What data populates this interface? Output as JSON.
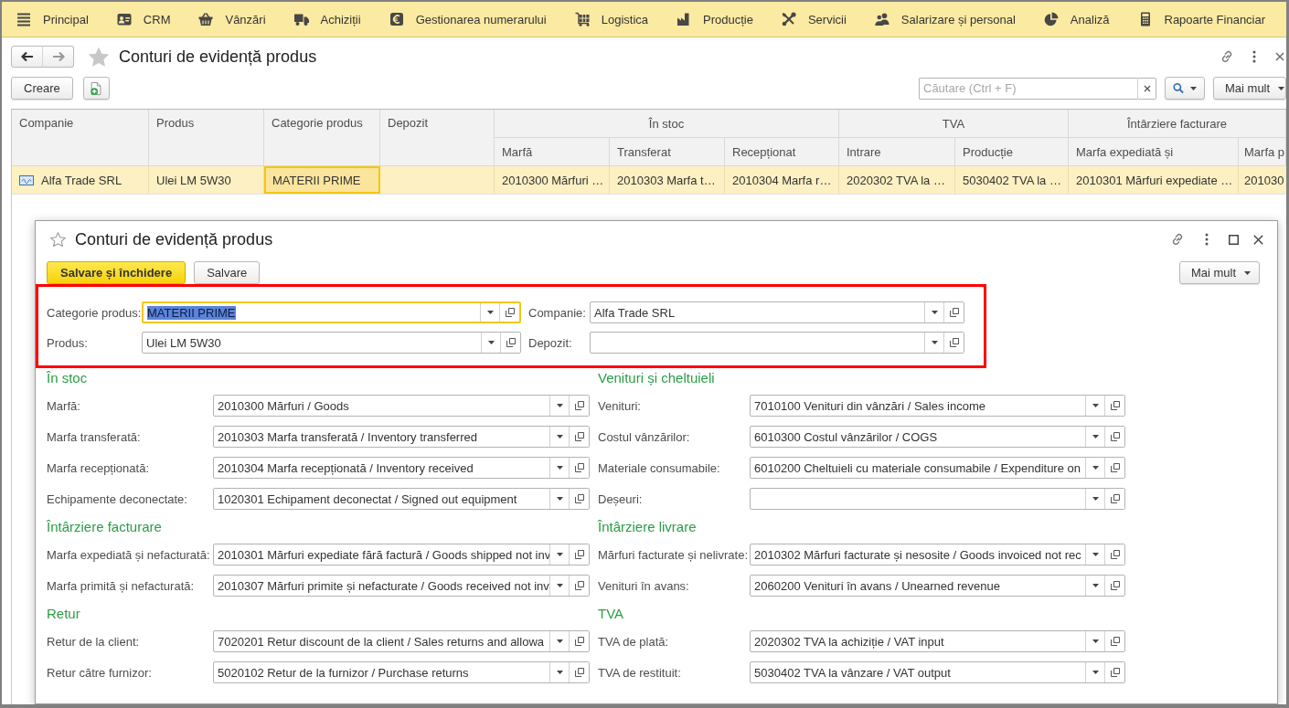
{
  "menu_bar": {
    "items": [
      "Principal",
      "CRM",
      "Vânzări",
      "Achiziții",
      "Gestionarea numerarului",
      "Logistica",
      "Producție",
      "Servicii",
      "Salarizare și personal",
      "Analiză",
      "Rapoarte Financiar"
    ]
  },
  "page": {
    "title": "Conturi de evidență produs",
    "favorite": false,
    "create_button": "Creare",
    "search": {
      "placeholder": "Căutare (Ctrl + F)"
    },
    "more_button": "Mai mult"
  },
  "table": {
    "columns": [
      {
        "label": "Companie"
      },
      {
        "label": "Produs"
      },
      {
        "label": "Categorie produs"
      },
      {
        "label": "Depozit"
      }
    ],
    "column_groups": [
      {
        "label": "În stoc",
        "columns": [
          "Marfă",
          "Transferat",
          "Recepționat"
        ]
      },
      {
        "label": "TVA",
        "columns": [
          "Intrare",
          "Producție"
        ]
      },
      {
        "label": "Întârziere facturare",
        "columns": [
          "Marfa expediată și",
          "Marfa p"
        ]
      }
    ],
    "rows": [
      {
        "selected": true,
        "cells": [
          {
            "text": "Alfa Trade SRL",
            "focused": false
          },
          {
            "text": "Ulei LM 5W30",
            "focused": false
          },
          {
            "text": "MATERII PRIME",
            "focused": true
          },
          {
            "focused": false
          },
          {
            "text": "2010300 Mărfuri …",
            "focused": false
          },
          {
            "text": "2010303 Marfa t…",
            "focused": false
          },
          {
            "text": "2010304 Marfa r…",
            "focused": false
          },
          {
            "text": "2020302 TVA la …",
            "focused": false
          },
          {
            "text": "5030402 TVA la …",
            "focused": false
          },
          {
            "text": "2010301 Mărfuri expediate …",
            "focused": false
          },
          {
            "text": "201030",
            "focused": false
          }
        ]
      }
    ]
  },
  "dialog": {
    "title": "Conturi de evidență produs",
    "favorite": false,
    "save_close_button": "Salvare și închidere",
    "save_button": "Salvare",
    "more_button": "Mai mult",
    "header": {
      "highlighted": true,
      "fields": [
        {
          "label": "Categorie produs:",
          "value": "MATERII PRIME",
          "focused": true,
          "text_selected": true
        },
        {
          "label": "Companie:",
          "value": "Alfa Trade SRL",
          "focused": false,
          "text_selected": false
        },
        {
          "label": "Produs:",
          "value": "Ulei LM 5W30",
          "focused": false,
          "text_selected": false
        },
        {
          "label": "Depozit:",
          "focused": false
        }
      ]
    },
    "form_columns": [
      {
        "sections": [
          {
            "title": "În stoc",
            "fields": [
              {
                "label": "Marfă:",
                "value": "2010300 Mărfuri / Goods"
              },
              {
                "label": "Marfa transferată:",
                "value": "2010303 Marfa transferată / Inventory transferred"
              },
              {
                "label": "Marfa recepționată:",
                "value": "2010304 Marfa recepționată / Inventory received"
              },
              {
                "label": "Echipamente deconectate:",
                "value": "1020301 Echipament deconectat / Signed out equipment"
              }
            ]
          },
          {
            "title": "Întârziere facturare",
            "fields": [
              {
                "label": "Marfa expediată și nefacturată:",
                "value": "2010301 Mărfuri expediate fără factură / Goods shipped not inv"
              },
              {
                "label": "Marfa primită și nefacturată:",
                "value": "2010307 Mărfuri primite și nefacturate / Goods received not inv"
              }
            ]
          },
          {
            "title": "Retur",
            "fields": [
              {
                "label": "Retur de la client:",
                "value": "7020201 Retur discount de la client / Sales returns and allowa"
              },
              {
                "label": "Retur către furnizor:",
                "value": "5020102 Retur de la furnizor / Purchase returns"
              }
            ]
          }
        ]
      },
      {
        "sections": [
          {
            "title": "Venituri și cheltuieli",
            "fields": [
              {
                "label": "Venituri:",
                "value": "7010100 Venituri din vânzări / Sales income"
              },
              {
                "label": "Costul vânzărilor:",
                "value": "6010300 Costul vânzărilor / COGS"
              },
              {
                "label": "Materiale consumabile:",
                "value": "6010200 Cheltuieli cu materiale consumabile / Expenditure on"
              },
              {
                "label": "Deșeuri:"
              }
            ]
          },
          {
            "title": "Întârziere livrare",
            "fields": [
              {
                "label": "Mărfuri facturate și nelivrate:",
                "value": "2010302 Mărfuri facturate și nesosite / Goods invoiced not rec"
              },
              {
                "label": "Venituri în avans:",
                "value": "2060200 Venituri în avans / Unearned revenue"
              }
            ]
          },
          {
            "title": "TVA",
            "fields": [
              {
                "label": "TVA de plată:",
                "value": "2020302 TVA la achiziție / VAT input"
              },
              {
                "label": "TVA de restituit:",
                "value": "5030402 TVA la vânzare / VAT output"
              }
            ]
          }
        ]
      }
    ]
  }
}
